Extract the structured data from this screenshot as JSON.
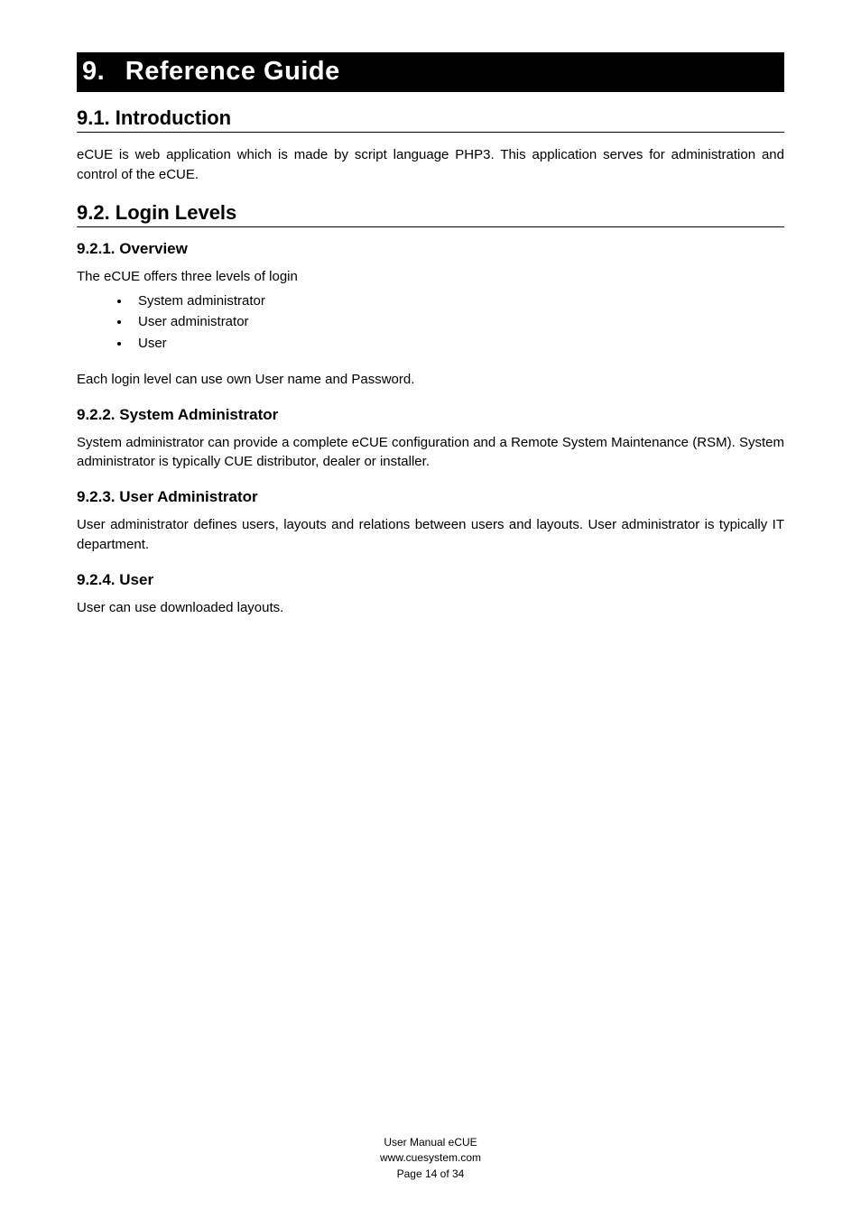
{
  "chapter": {
    "number": "9.",
    "title": "Reference Guide"
  },
  "sections": {
    "intro": {
      "heading": "9.1. Introduction",
      "paragraph": "eCUE is web application which is made by script language PHP3. This application serves for administration and control of the eCUE."
    },
    "loginLevels": {
      "heading": "9.2. Login Levels",
      "overview": {
        "heading": "9.2.1. Overview",
        "intro": "The eCUE offers three levels of login",
        "items": [
          "System administrator",
          "User administrator",
          "User"
        ],
        "trailing": "Each login level can use own User name and Password."
      },
      "systemAdmin": {
        "heading": "9.2.2. System Administrator",
        "paragraph": "System administrator can provide a complete eCUE configuration and a Remote System Maintenance (RSM). System administrator is typically CUE distributor, dealer or installer."
      },
      "userAdmin": {
        "heading": "9.2.3. User Administrator",
        "paragraph": "User administrator defines users, layouts and relations between users and layouts. User administrator is typically IT department."
      },
      "user": {
        "heading": "9.2.4. User",
        "paragraph": "User can use downloaded layouts."
      }
    }
  },
  "footer": {
    "line1": "User Manual eCUE",
    "line2": "www.cuesystem.com",
    "line3": "Page 14 of 34"
  }
}
